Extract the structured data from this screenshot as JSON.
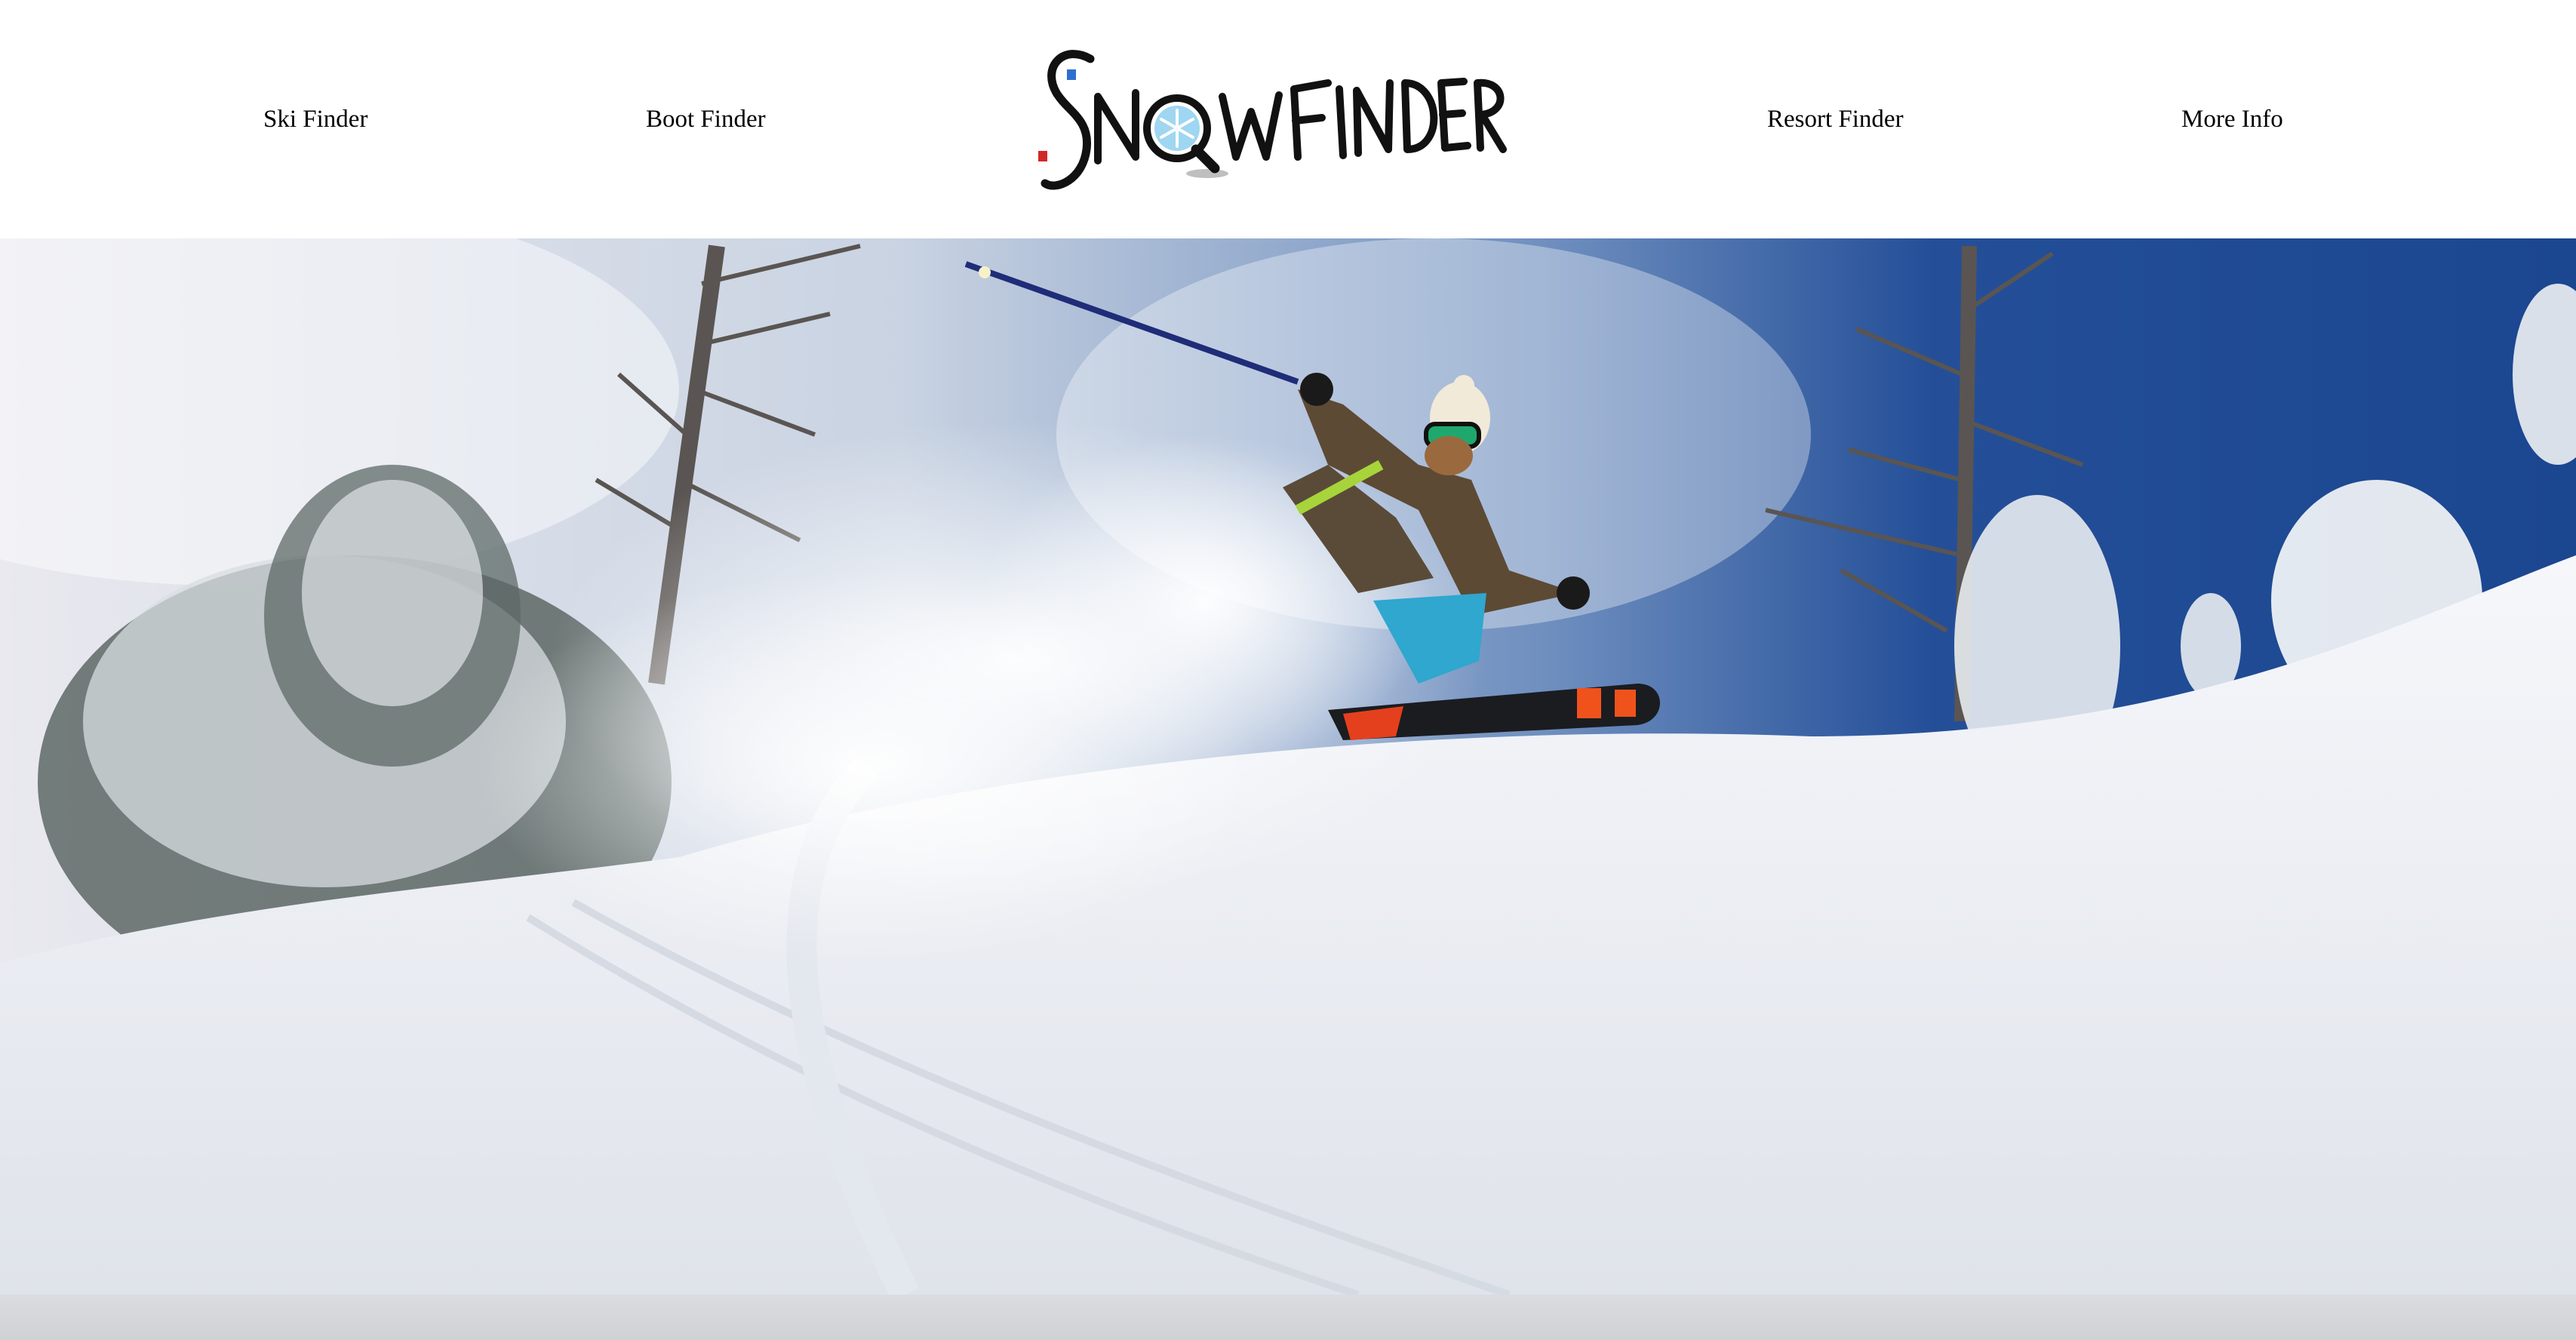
{
  "header": {
    "nav_left": [
      {
        "label": "Ski Finder"
      },
      {
        "label": "Boot Finder"
      }
    ],
    "nav_right": [
      {
        "label": "Resort Finder"
      },
      {
        "label": "More Info"
      }
    ],
    "logo_text": "SNOWFINDER"
  },
  "hero": {
    "image": "skier-carving-powder",
    "sky_color": "#1f4f96",
    "snow_color": "#eef1f5"
  },
  "icons": {
    "logo_magnifier": "snowflake-magnifier-icon",
    "logo_ski_marks": "ski-binding-icon"
  }
}
